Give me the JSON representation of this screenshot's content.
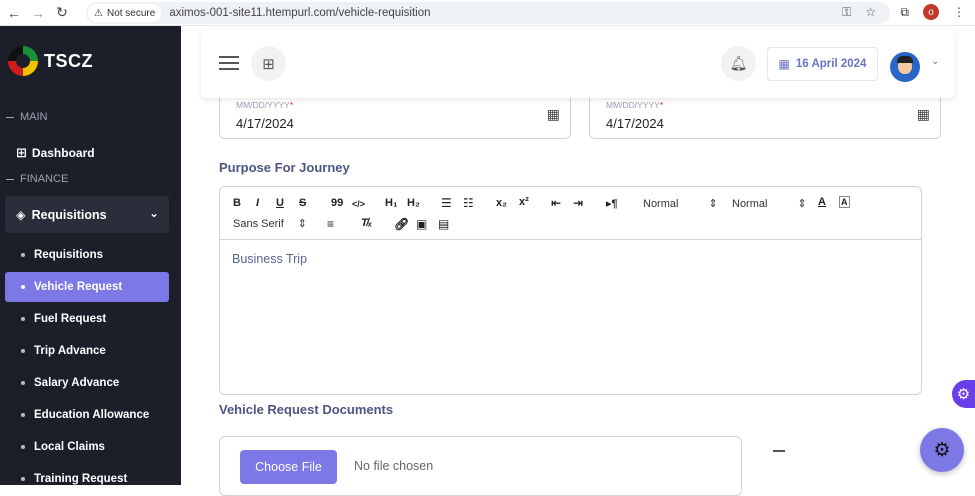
{
  "browser": {
    "security_label": "Not secure",
    "url": "aximos-001-site11.htempurl.com/vehicle-requisition",
    "profile_initial": "o"
  },
  "sidebar": {
    "brand": "TSCZ",
    "section_main": "MAIN",
    "dashboard": "Dashboard",
    "section_finance": "FINANCE",
    "group_label": "Requisitions",
    "items": [
      {
        "label": "Requisitions",
        "active": false
      },
      {
        "label": "Vehicle Request",
        "active": true
      },
      {
        "label": "Fuel Request",
        "active": false
      },
      {
        "label": "Trip Advance",
        "active": false
      },
      {
        "label": "Salary Advance",
        "active": false
      },
      {
        "label": "Education Allowance",
        "active": false
      },
      {
        "label": "Local Claims",
        "active": false
      },
      {
        "label": "Training Request",
        "active": false
      }
    ]
  },
  "header": {
    "date": "16 April 2024"
  },
  "form": {
    "date_placeholder": "MM/DD/YYYY",
    "required_mark": "*",
    "start_date": "4/17/2024",
    "end_date": "4/17/2024",
    "purpose_label": "Purpose For Journey",
    "purpose_text": "Business Trip",
    "documents_label": "Vehicle Request Documents",
    "choose_file_label": "Choose File",
    "no_file_text": "No file chosen"
  },
  "editor_toolbar": {
    "bold": "B",
    "italic": "I",
    "underline": "U",
    "strike": "S",
    "blockquote": "99",
    "code": "</>",
    "h1": "H₁",
    "h2": "H₂",
    "subscript": "x₂",
    "superscript": "x²",
    "direction": "▸¶",
    "header_select": "Normal",
    "size_select": "Normal",
    "font_select": "Sans Serif"
  },
  "colors": {
    "accent": "#7c78e6",
    "sidebar_bg": "#1c1f2a",
    "label_color": "#4e5585"
  }
}
